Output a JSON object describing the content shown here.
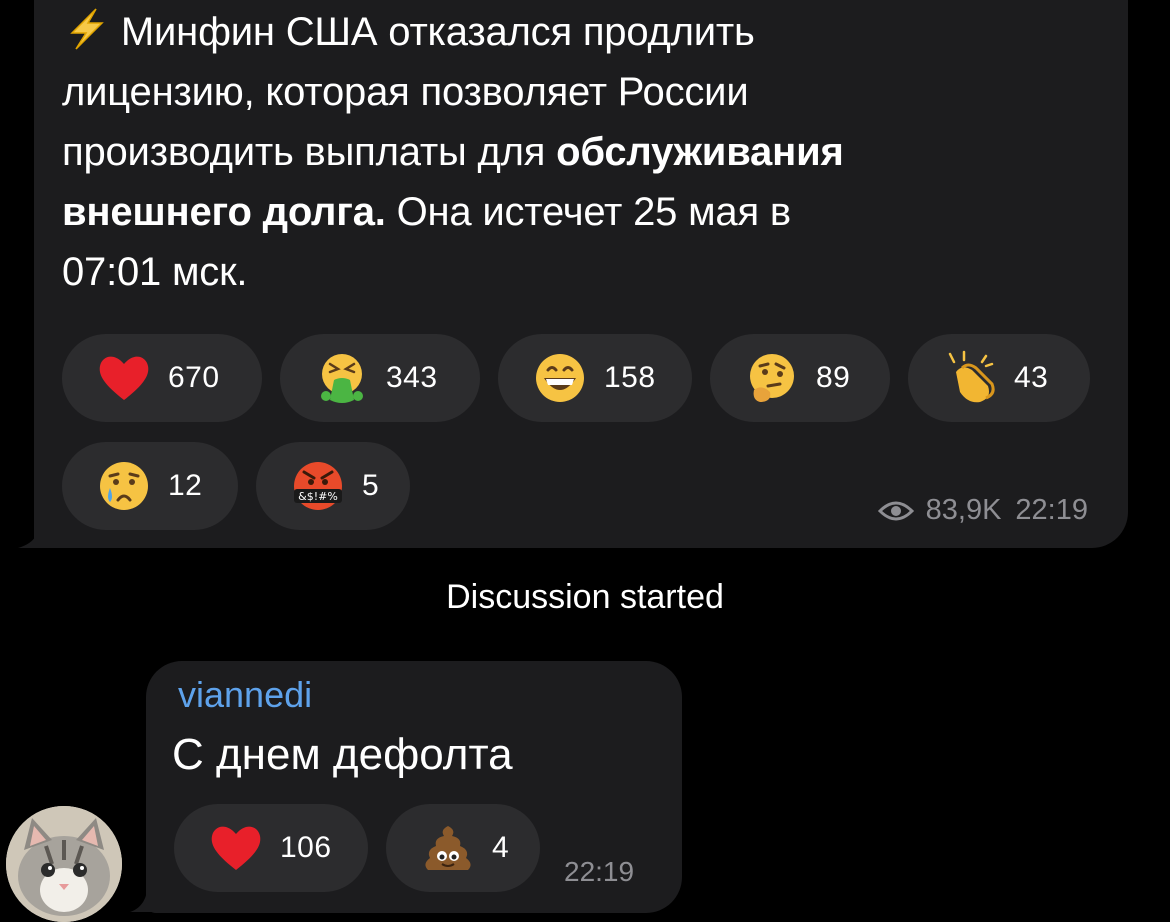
{
  "post": {
    "line1": "Минфин США отказался продлить",
    "line2": "лицензию, которая позволяет России",
    "line3_a": "производить выплаты для ",
    "line3_b": "обслуживания",
    "line4_a": "внешнего долга.",
    "line4_b": " Она истечет 25 мая в",
    "line5": "07:01 мск.",
    "reactions": [
      {
        "emoji": "red-heart",
        "count": "670"
      },
      {
        "emoji": "vomiting-face",
        "count": "343"
      },
      {
        "emoji": "grinning-face",
        "count": "158"
      },
      {
        "emoji": "thinking-face",
        "count": "89"
      },
      {
        "emoji": "clapping-hands",
        "count": "43"
      },
      {
        "emoji": "crying-face",
        "count": "12"
      },
      {
        "emoji": "cursing-face",
        "count": "5"
      }
    ],
    "cursing_glyph": "&$!#%",
    "views": "83,9K",
    "time": "22:19"
  },
  "service_message": "Discussion started",
  "comment": {
    "author": "viannedi",
    "text": "С днем дефолта",
    "reactions": [
      {
        "emoji": "red-heart",
        "count": "106"
      },
      {
        "emoji": "pile-of-poo",
        "count": "4"
      }
    ],
    "time": "22:19"
  },
  "colors": {
    "background": "#000000",
    "bubble": "#1c1c1e",
    "reaction_pill": "#2c2c2e",
    "author_name": "#5ea2eb",
    "meta_text": "#8e8e93"
  }
}
